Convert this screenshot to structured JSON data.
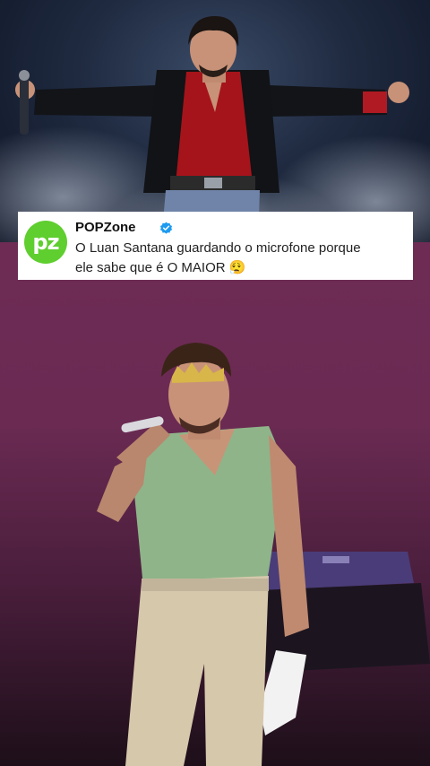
{
  "post": {
    "avatar_text": "pz",
    "name": "POPZone",
    "verified": true,
    "text_line1": "O Luan Santana guardando o microfone porque",
    "text_line2": "ele sabe que é O MAIOR 😮‍💨"
  },
  "colors": {
    "avatar_bg": "#5fce2f",
    "verified_badge": "#1d9bf0",
    "top_bg": "#1f2a40",
    "bottom_bg": "#6a2a52"
  }
}
